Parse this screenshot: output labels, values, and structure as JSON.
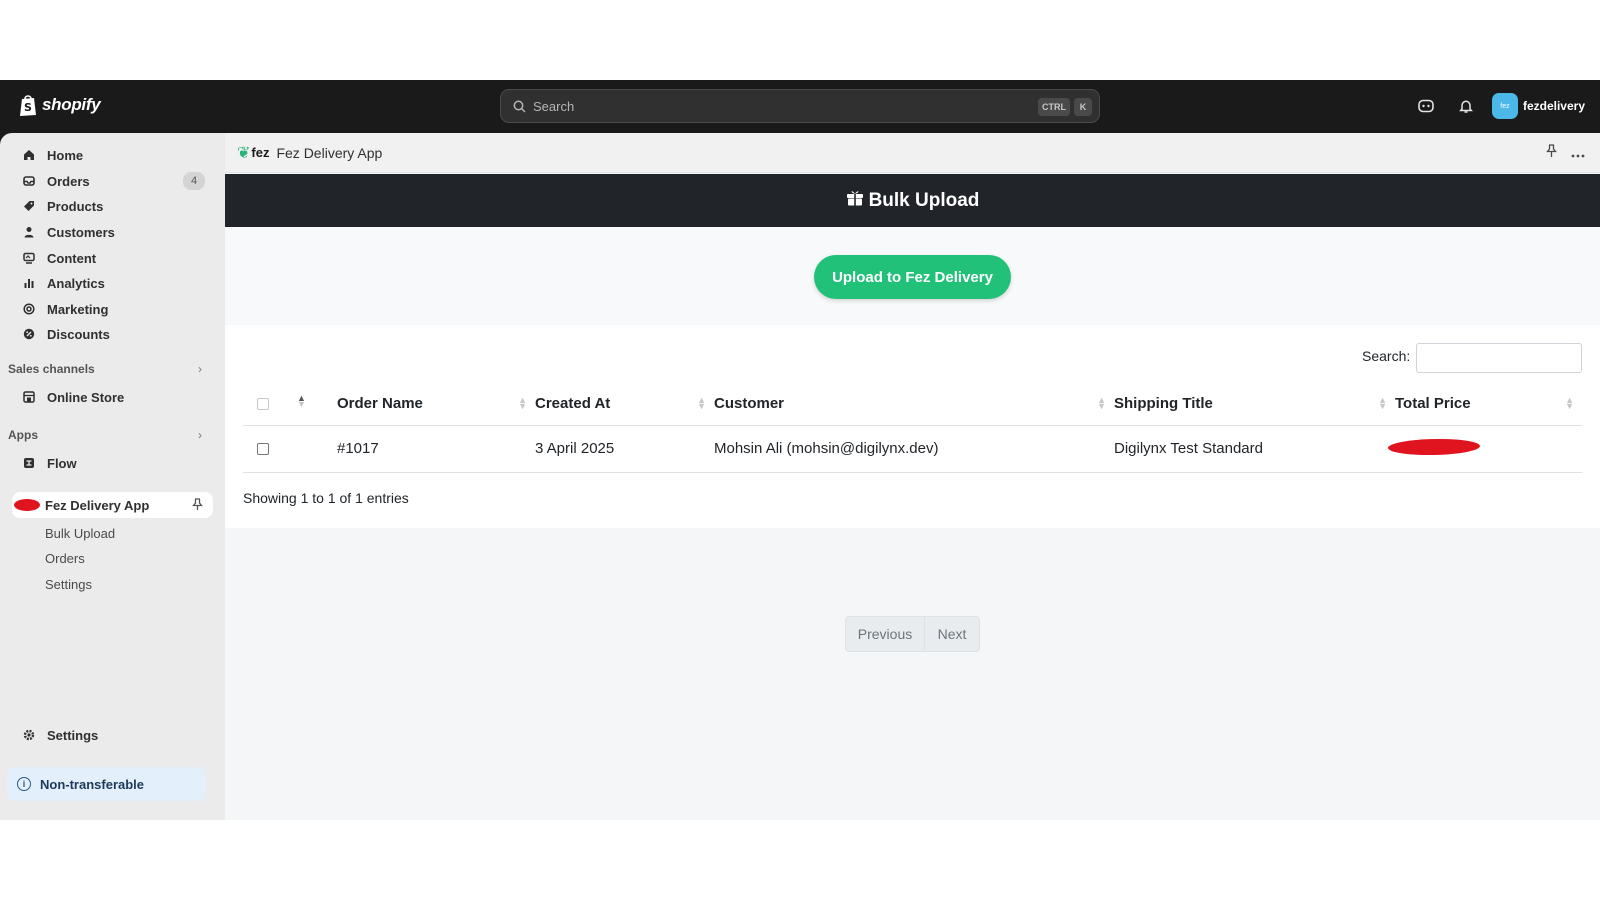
{
  "topbar": {
    "logo_text": "shopify",
    "search_placeholder": "Search",
    "kbd_ctrl": "CTRL",
    "kbd_k": "K",
    "account_initials": "fez",
    "account_name": "fezdelivery"
  },
  "sidebar": {
    "items": [
      {
        "label": "Home",
        "icon": "home-icon"
      },
      {
        "label": "Orders",
        "icon": "orders-icon",
        "badge": "4"
      },
      {
        "label": "Products",
        "icon": "tag-icon"
      },
      {
        "label": "Customers",
        "icon": "person-icon"
      },
      {
        "label": "Content",
        "icon": "content-icon"
      },
      {
        "label": "Analytics",
        "icon": "bar-chart-icon"
      },
      {
        "label": "Marketing",
        "icon": "target-icon"
      },
      {
        "label": "Discounts",
        "icon": "discount-icon"
      }
    ],
    "sales_channels_label": "Sales channels",
    "online_store_label": "Online Store",
    "apps_label": "Apps",
    "flow_label": "Flow",
    "app_name": "Fez Delivery App",
    "app_subitems": [
      "Bulk Upload",
      "Orders",
      "Settings"
    ],
    "settings_label": "Settings",
    "nontransferable_label": "Non-transferable"
  },
  "app": {
    "logo_text": "fez",
    "title": "Fez Delivery App",
    "banner_title": "Bulk Upload",
    "upload_button": "Upload to Fez Delivery",
    "search_label": "Search:",
    "columns": [
      "Order Name",
      "Created At",
      "Customer",
      "Shipping Title",
      "Total Price"
    ],
    "rows": [
      {
        "order_name": "#1017",
        "created_at": "3 April 2025",
        "customer": "Mohsin Ali (mohsin@digilynx.dev)",
        "shipping_title": "Digilynx Test Standard",
        "total_price": ""
      }
    ],
    "showing_text": "Showing 1 to 1 of 1 entries",
    "prev_label": "Previous",
    "next_label": "Next"
  },
  "colors": {
    "topbar": "#1a1a1a",
    "banner": "#212529",
    "upload_button": "#22c17a",
    "redaction": "#e0141e"
  }
}
